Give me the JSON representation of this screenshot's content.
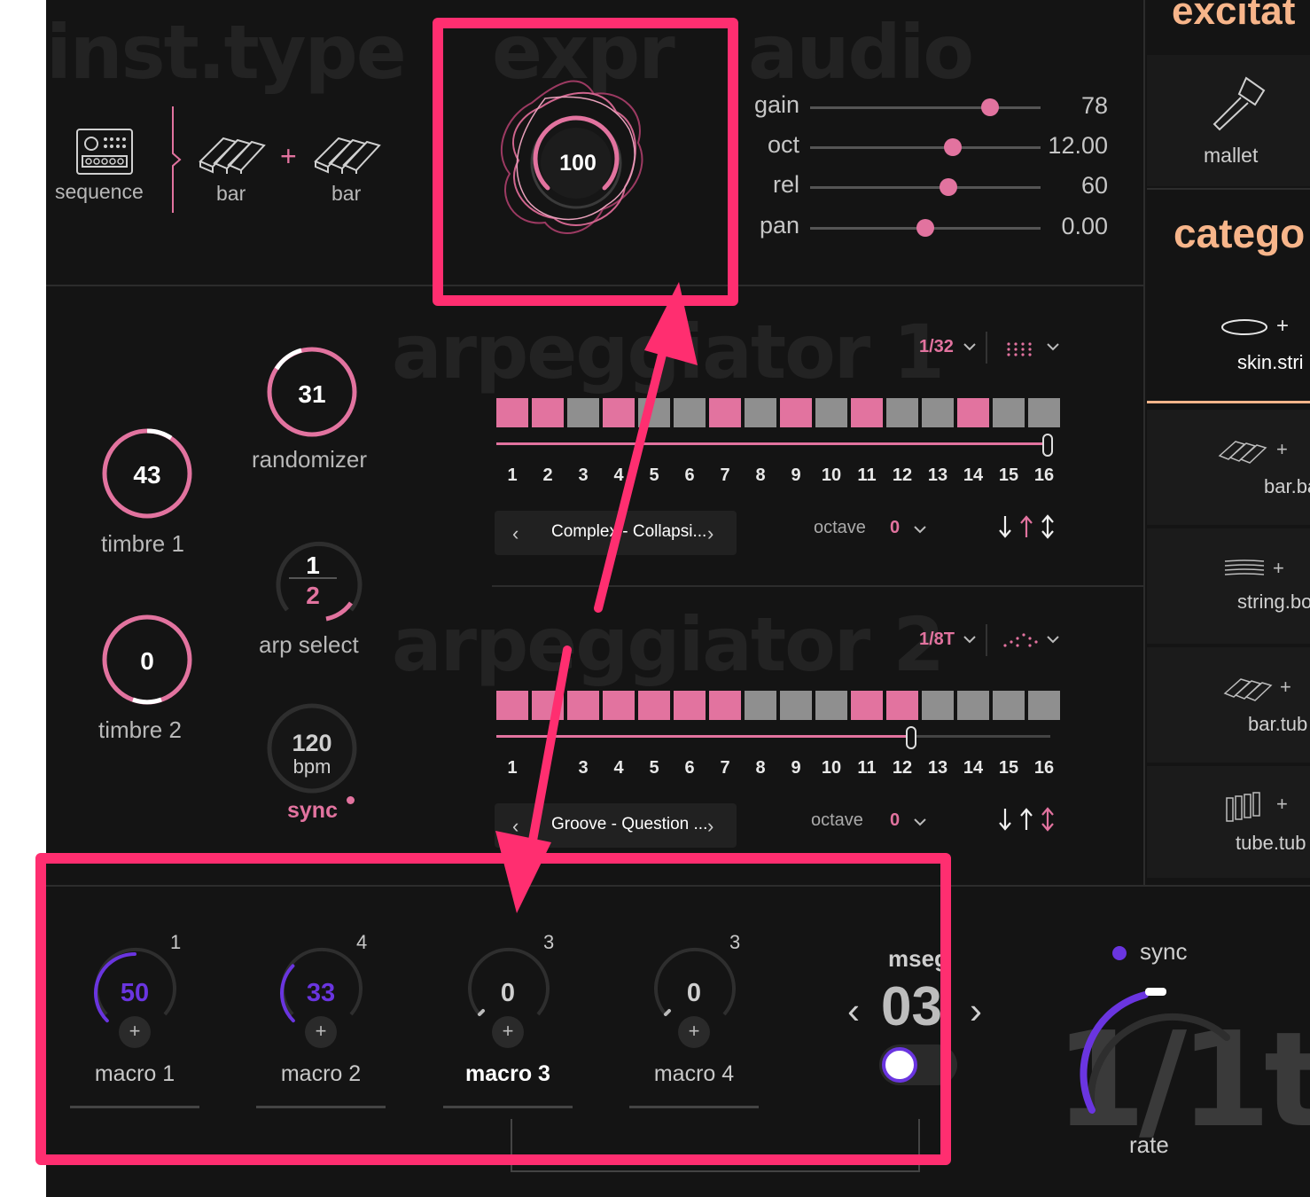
{
  "inst_type": {
    "ghost_title": "inst.type",
    "sequence_label": "sequence",
    "bar1_label": "bar",
    "plus": "+",
    "bar2_label": "bar"
  },
  "expr": {
    "ghost_title": "expr",
    "knob_value": "100"
  },
  "audio": {
    "ghost_title": "audio",
    "sliders": [
      {
        "name": "gain",
        "value": "78",
        "fraction": 0.78
      },
      {
        "name": "oct",
        "value": "12.00",
        "fraction": 0.62
      },
      {
        "name": "rel",
        "value": "60",
        "fraction": 0.6
      },
      {
        "name": "pan",
        "value": "0.00",
        "fraction": 0.5
      }
    ]
  },
  "exciter": {
    "title": "excitat",
    "mallet_label": "mallet"
  },
  "category": {
    "title": "catego",
    "items": [
      {
        "label": "skin.stri",
        "plus": "+"
      },
      {
        "label": "bar.ba",
        "plus": "+"
      },
      {
        "label": "string.bo",
        "plus": "+"
      },
      {
        "label": "bar.tub",
        "plus": "+"
      },
      {
        "label": "tube.tub",
        "plus": "+"
      }
    ]
  },
  "left_controls": {
    "timbre1": {
      "value": "43",
      "label": "timbre 1",
      "fraction": 0.43
    },
    "timbre2": {
      "value": "0",
      "label": "timbre 2",
      "fraction": 0.0
    },
    "randomizer": {
      "value": "31",
      "label": "randomizer",
      "fraction": 0.31
    },
    "arp_select": {
      "top": "1",
      "bottom": "2",
      "label": "arp select"
    },
    "bpm": {
      "value": "120",
      "unit": "bpm",
      "sync_label": "sync"
    }
  },
  "arp1": {
    "ghost_title": "arpeggiator 1",
    "rate": "1/32",
    "steps_active": [
      1,
      1,
      0,
      1,
      0,
      0,
      1,
      0,
      1,
      0,
      1,
      0,
      0,
      1,
      0,
      0
    ],
    "step_numbers": [
      "1",
      "2",
      "3",
      "4",
      "5",
      "6",
      "7",
      "8",
      "9",
      "10",
      "11",
      "12",
      "13",
      "14",
      "15",
      "16"
    ],
    "length_fraction": 1.0,
    "preset": "Complex - Collapsi...",
    "prev": "‹",
    "next": "›",
    "octave_label": "octave",
    "octave_value": "0"
  },
  "arp2": {
    "ghost_title": "arpeggiator 2",
    "rate": "1/8T",
    "steps_active": [
      1,
      1,
      1,
      1,
      1,
      1,
      1,
      0,
      0,
      0,
      1,
      1,
      0,
      0,
      0,
      0
    ],
    "step_numbers": [
      "1",
      "",
      "3",
      "4",
      "5",
      "6",
      "7",
      "8",
      "9",
      "10",
      "11",
      "12",
      "13",
      "14",
      "15",
      "16"
    ],
    "length_fraction": 0.75,
    "preset": "Groove - Question ...",
    "prev": "‹",
    "next": "›",
    "octave_label": "octave",
    "octave_value": "0"
  },
  "macros": [
    {
      "name": "macro 1",
      "value": "50",
      "count": "1",
      "fraction": 0.5,
      "selected": false
    },
    {
      "name": "macro 2",
      "value": "33",
      "count": "4",
      "fraction": 0.33,
      "selected": false
    },
    {
      "name": "macro 3",
      "value": "0",
      "count": "3",
      "fraction": 0.0,
      "selected": true
    },
    {
      "name": "macro 4",
      "value": "0",
      "count": "3",
      "fraction": 0.0,
      "selected": false
    }
  ],
  "mseg": {
    "title": "mseg",
    "number": "03",
    "prev": "‹",
    "next": "›"
  },
  "lfo": {
    "sync_label": "sync",
    "rate_ghost": "1/1t",
    "rate_label": "rate"
  },
  "colors": {
    "pink": "#e2739f",
    "highlight": "#ff2e70",
    "purple": "#6a35e0",
    "orange": "#f7b58a"
  }
}
